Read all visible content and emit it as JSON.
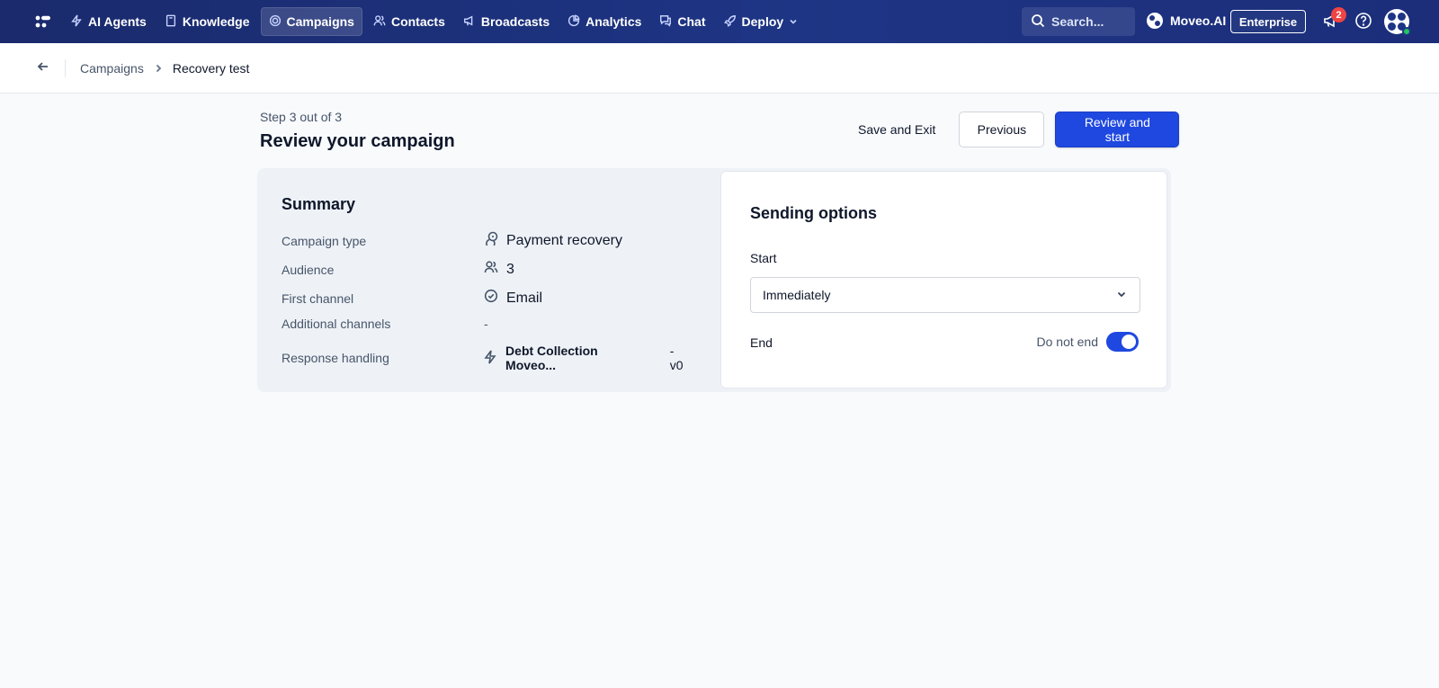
{
  "nav": {
    "items": [
      {
        "label": "AI Agents",
        "icon": "bolt-icon"
      },
      {
        "label": "Knowledge",
        "icon": "book-icon"
      },
      {
        "label": "Campaigns",
        "icon": "campaign-icon",
        "active": true
      },
      {
        "label": "Contacts",
        "icon": "users-icon"
      },
      {
        "label": "Broadcasts",
        "icon": "megaphone-icon"
      },
      {
        "label": "Analytics",
        "icon": "pie-chart-icon"
      },
      {
        "label": "Chat",
        "icon": "chat-icon"
      },
      {
        "label": "Deploy",
        "icon": "rocket-icon"
      }
    ],
    "search_placeholder": "Search...",
    "org_name": "Moveo.AI",
    "plan": "Enterprise",
    "notification_count": "2"
  },
  "breadcrumb": {
    "parent": "Campaigns",
    "current": "Recovery test"
  },
  "header": {
    "step": "Step 3 out of 3",
    "title": "Review your campaign",
    "save_exit": "Save and Exit",
    "previous": "Previous",
    "review_start": "Review and start"
  },
  "summary": {
    "title": "Summary",
    "campaign_type_label": "Campaign type",
    "campaign_type_value": "Payment recovery",
    "audience_label": "Audience",
    "audience_value": "3",
    "first_channel_label": "First channel",
    "first_channel_value": "Email",
    "additional_channels_label": "Additional channels",
    "additional_channels_value": "-",
    "response_handling_label": "Response handling",
    "response_handling_value": "Debt Collection Moveo...",
    "response_handling_version": "- v0"
  },
  "sending": {
    "title": "Sending options",
    "start_label": "Start",
    "start_value": "Immediately",
    "end_label": "End",
    "end_toggle_label": "Do not end",
    "end_toggle_on": true
  },
  "colors": {
    "nav_bg": "#1e3585",
    "primary": "#1f48e0",
    "badge": "#ef4444"
  }
}
